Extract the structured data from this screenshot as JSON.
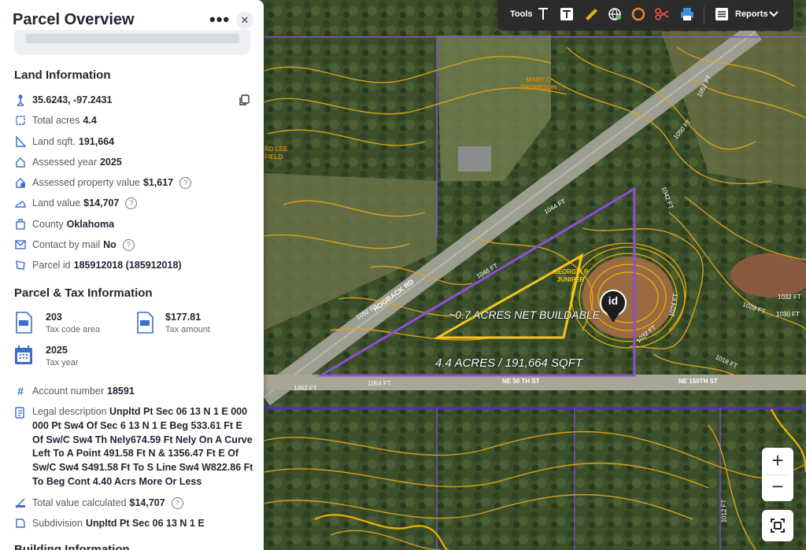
{
  "panel": {
    "title": "Parcel Overview",
    "more_label": "•••",
    "close_label": "✕",
    "land_heading": "Land Information",
    "coords": "35.6243, -97.2431",
    "rows": [
      {
        "label": "Total acres",
        "value": "4.4"
      },
      {
        "label": "Land sqft.",
        "value": "191,664"
      },
      {
        "label": "Assessed year",
        "value": "2025"
      },
      {
        "label": "Assessed property value",
        "value": "$1,617"
      },
      {
        "label": "Land value",
        "value": "$14,707"
      },
      {
        "label": "County",
        "value": "Oklahoma"
      },
      {
        "label": "Contact by mail",
        "value": "No"
      },
      {
        "label": "Parcel id",
        "value": "185912018 (185912018)"
      }
    ],
    "tax_heading": "Parcel & Tax Information",
    "tax": {
      "code_area_value": "203",
      "code_area_label": "Tax code area",
      "amount_value": "$177.81",
      "amount_label": "Tax amount",
      "year_value": "2025",
      "year_label": "Tax year"
    },
    "account": {
      "label": "Account number",
      "value": "18591"
    },
    "legal": {
      "label": "Legal description",
      "value": "Unpltd Pt Sec 06 13 N 1 E 000 000 Pt Sw4 Of Sec 6 13 N 1 E Beg 533.61 Ft E Of Sw/C Sw4 Th Nely674.59 Ft Nely On A Curve Left To A Point 491.58 Ft N & 1356.47 Ft E Of Sw/C Sw4 S491.58 Ft To S Line Sw4 W822.86 Ft To Beg Cont 4.40 Acrs More Or Less"
    },
    "total_value": {
      "label": "Total value calculated",
      "value": "$14,707"
    },
    "subdivision": {
      "label": "Subdivision",
      "value": "Unpltd Pt Sec 06 13 N 1 E"
    },
    "building_heading": "Building Information"
  },
  "toolbar": {
    "tools_label": "Tools",
    "reports_label": "Reports"
  },
  "map": {
    "owner_label_1": "MARY C",
    "owner_label_2": "THOMPSON",
    "owner_label_3": "GEORGIA P",
    "owner_label_4": "JUNIPER",
    "owner_label_5": "RD LEE",
    "owner_label_6": "FIELD",
    "road_label": "HOGBACK RD",
    "street_1": "NE 50 TH ST",
    "street_2": "NE 150TH ST",
    "buildable_label": "~0.7 ACRES NET BUILDABLE",
    "parcel_label": "4.4 ACRES / 191,664 SQFT",
    "marker_label": "id",
    "contours": [
      "1052 FT",
      "1050 FT",
      "1044 FT",
      "1048 FT",
      "1052 FT",
      "1054 FT",
      "1052 FT",
      "1042 FT",
      "1032 FT",
      "1028 FT",
      "1030 FT",
      "1032 FT",
      "1024 FT",
      "1032 FT",
      "1018 FT",
      "1012 FT"
    ],
    "zoom_in": "+",
    "zoom_out": "−",
    "colors": {
      "contour": "#e0a51a",
      "parcel": "#8c4fd6",
      "buildable": "#f5c518"
    }
  }
}
